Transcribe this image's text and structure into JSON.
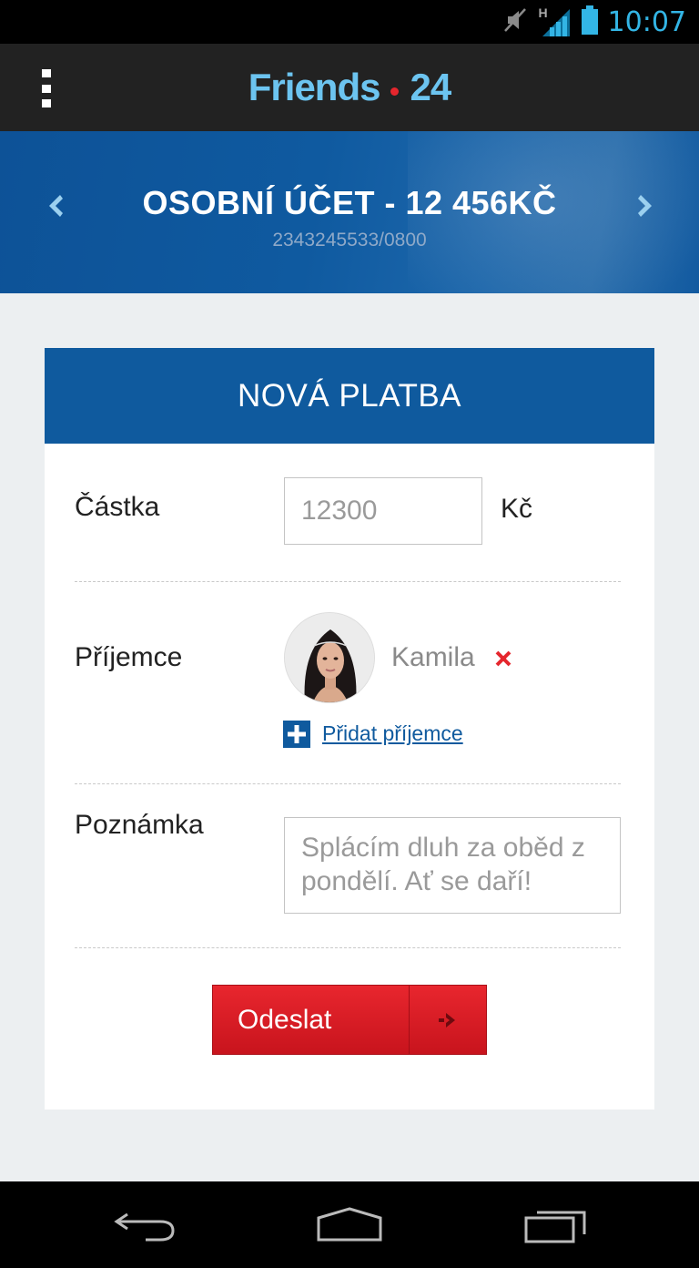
{
  "status_bar": {
    "time": "10:07",
    "icons": [
      "mute-icon",
      "signal-icon",
      "battery-icon"
    ],
    "network_label": "H"
  },
  "app_bar": {
    "brand_name": "Friends",
    "brand_number": "24",
    "menu_icon": "overflow-menu-icon"
  },
  "account": {
    "title": "OSOBNÍ ÚČET - 12 456KČ",
    "number": "2343245533/0800",
    "prev_icon": "chevron-left-icon",
    "next_icon": "chevron-right-icon"
  },
  "form": {
    "header": "NOVÁ PLATBA",
    "amount_label": "Částka",
    "amount_value": "12300",
    "currency": "Kč",
    "recipient_label": "Příjemce",
    "recipient_name": "Kamila",
    "add_recipient_label": "Přidat příjemce",
    "note_label": "Poznámka",
    "note_value": "Splácím dluh za oběd z pondělí. Ať se daří!",
    "send_label": "Odeslat"
  },
  "colors": {
    "brand_blue": "#0f5a9e",
    "brand_light_blue": "#6cc4f0",
    "accent_red": "#e5262d",
    "status_blue": "#33b5e5"
  },
  "nav_bar": {
    "icons": [
      "back-icon",
      "home-icon",
      "recent-apps-icon"
    ]
  }
}
